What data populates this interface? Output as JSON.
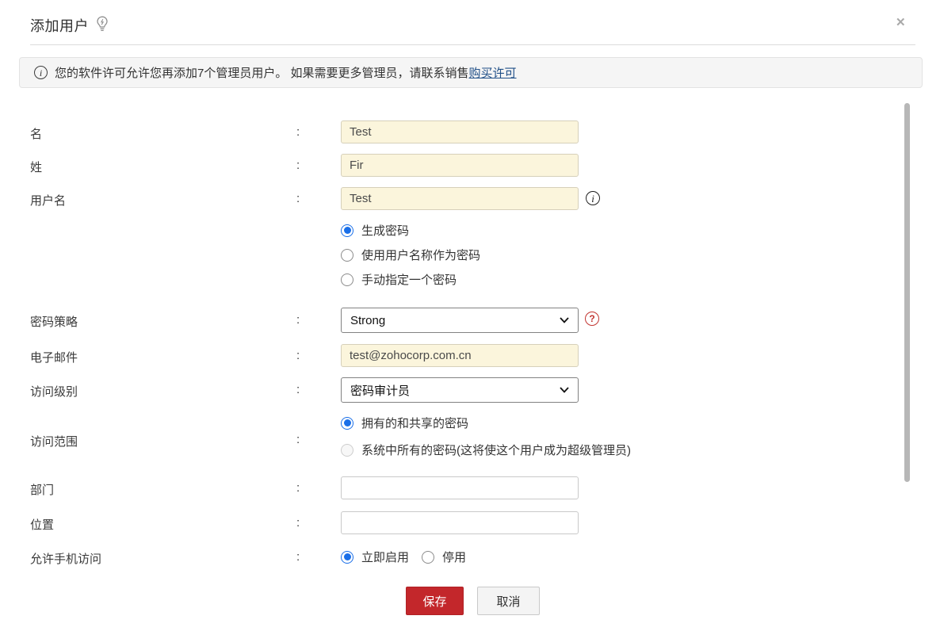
{
  "colors": {
    "save_button": "#c3272b",
    "radio_selected": "#1a6fe8",
    "link": "#215088",
    "autofill_input_bg": "#fbf5dc"
  },
  "icons": {
    "title_hint": "lightbulb-bolt-icon",
    "banner_info": "info-circle-icon",
    "username_info": "info-circle-icon",
    "policy_help": "help-circle-icon",
    "close": "close-x-icon",
    "select_chevron": "chevron-down-icon"
  },
  "header": {
    "title": "添加用户",
    "close_glyph": "✕"
  },
  "banner": {
    "info_glyph": "i",
    "text_before_link": "您的软件许可允许您再添加7个管理员用户。 如果需要更多管理员，请联系销售",
    "link_text": "购买许可"
  },
  "form": {
    "colon": ":",
    "first_name": {
      "label": "名",
      "value": "Test"
    },
    "last_name": {
      "label": "姓",
      "value": "Fir"
    },
    "username": {
      "label": "用户名",
      "value": "Test",
      "info_glyph": "i"
    },
    "password_mode": {
      "options": [
        {
          "label": "生成密码",
          "selected": true
        },
        {
          "label": "使用用户名称作为密码",
          "selected": false
        },
        {
          "label": "手动指定一个密码",
          "selected": false
        }
      ]
    },
    "password_policy": {
      "label": "密码策略",
      "value": "Strong",
      "help_glyph": "?"
    },
    "email": {
      "label": "电子邮件",
      "value": "test@zohocorp.com.cn"
    },
    "access_level": {
      "label": "访问级别",
      "value": "密码审计员"
    },
    "access_scope": {
      "label": "访问范围",
      "options": [
        {
          "label": "拥有的和共享的密码",
          "selected": true
        },
        {
          "label": "系统中所有的密码(这将使这个用户成为超级管理员)",
          "selected": false
        }
      ]
    },
    "department": {
      "label": "部门",
      "value": ""
    },
    "location": {
      "label": "位置",
      "value": ""
    },
    "mobile_access": {
      "label": "允许手机访问",
      "options": [
        {
          "label": "立即启用",
          "selected": true
        },
        {
          "label": "停用",
          "selected": false
        }
      ]
    }
  },
  "actions": {
    "save": "保存",
    "cancel": "取消"
  }
}
